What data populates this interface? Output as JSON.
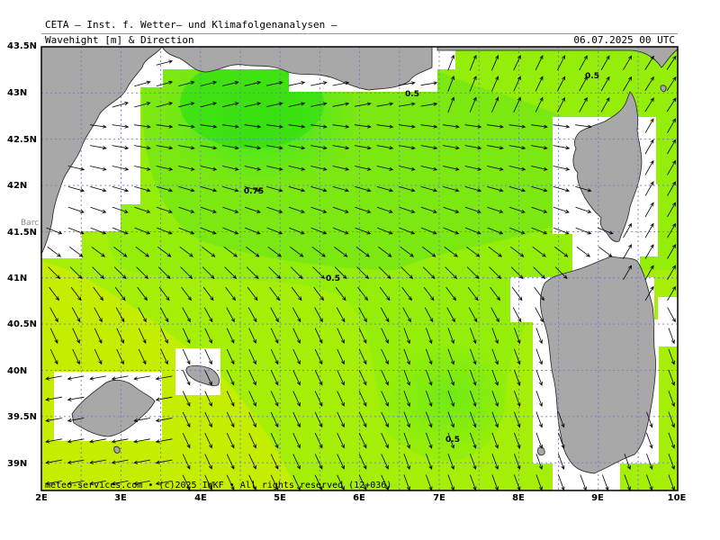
{
  "header": {
    "title": "CETA — Inst. f. Wetter— und Klimafolgenanalysen —",
    "subtitle": "Wavehight [m] & Direction",
    "datetime": "06.07.2025 00 UTC"
  },
  "lat_labels": [
    "43.5N",
    "43N",
    "42.5N",
    "42N",
    "41.5N",
    "41N",
    "40.5N",
    "40N",
    "39.5N",
    "39N"
  ],
  "lon_labels": [
    "2E",
    "3E",
    "4E",
    "5E",
    "6E",
    "7E",
    "8E",
    "9E",
    "10E"
  ],
  "contour_labels": [
    "0.5",
    "0.75",
    "0.5",
    "0.5"
  ],
  "place_label": "Barc",
  "footer": "meteo-services.com • (c)2025 IWKF • All rights reserved (12+036)",
  "colors": {
    "land": "#a8a8a8",
    "sea_low": "#c8f000",
    "sea_mid": "#9ef000",
    "sea_high": "#40e810",
    "grid": "#7777cc"
  }
}
